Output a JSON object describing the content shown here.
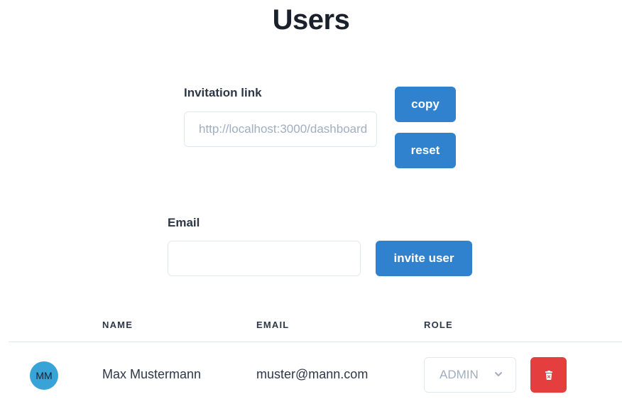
{
  "page": {
    "title": "Users"
  },
  "invitation": {
    "label": "Invitation link",
    "link_value": "http://localhost:3000/dashboard",
    "copy_label": "copy",
    "reset_label": "reset"
  },
  "invite": {
    "email_label": "Email",
    "email_value": "",
    "invite_label": "invite user"
  },
  "table": {
    "headers": {
      "name": "NAME",
      "email": "EMAIL",
      "role": "ROLE"
    },
    "rows": [
      {
        "initials": "MM",
        "name": "Max Mustermann",
        "email": "muster@mann.com",
        "role": "ADMIN"
      }
    ]
  },
  "colors": {
    "primary": "#3182ce",
    "danger": "#e53e3e",
    "avatar": "#38a3d6"
  },
  "icons": {
    "role_select": "chevron-down-icon",
    "delete": "trash-icon"
  }
}
